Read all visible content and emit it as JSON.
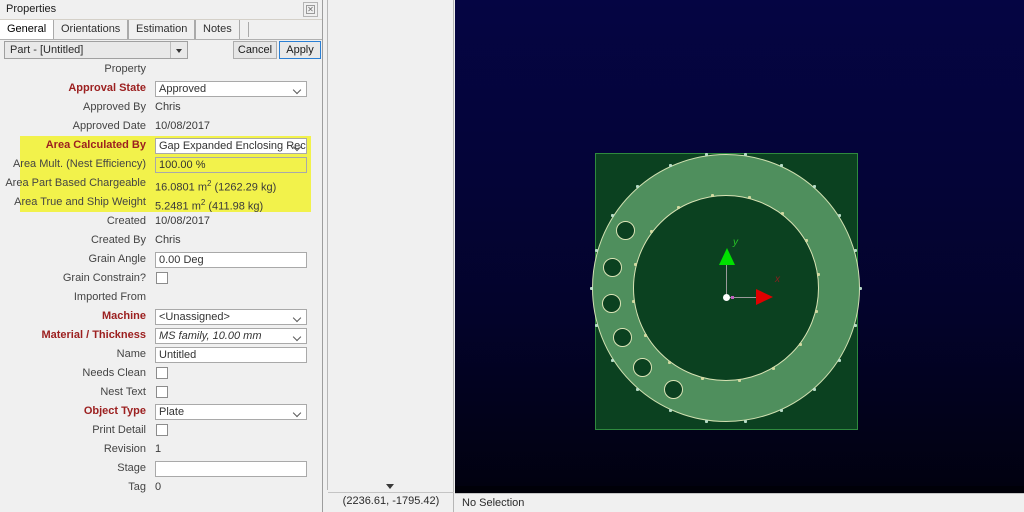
{
  "panel": {
    "title": "Properties",
    "dock_icon": "close-dock-icon",
    "tabs": [
      {
        "label": "General",
        "active": true
      },
      {
        "label": "Orientations",
        "active": false
      },
      {
        "label": "Estimation",
        "active": false
      },
      {
        "label": "Notes",
        "active": false
      }
    ],
    "part_selector": {
      "value": "Part - [Untitled]",
      "icon": "chevron-down-icon"
    },
    "cancel_label": "Cancel",
    "apply_label": "Apply",
    "header_row": "Property",
    "rows": [
      {
        "label": "Approval State",
        "value": "Approved",
        "type": "combo",
        "required": true,
        "highlight": false
      },
      {
        "label": "Approved By",
        "value": "Chris",
        "type": "text",
        "required": false,
        "highlight": false
      },
      {
        "label": "Approved Date",
        "value": "10/08/2017",
        "type": "text",
        "required": false,
        "highlight": false
      },
      {
        "label": "Area Calculated By",
        "value": "Gap Expanded Enclosing Rec",
        "type": "combo",
        "required": true,
        "highlight": true
      },
      {
        "label": "Area Mult. (Nest Efficiency)",
        "value": "100.00 %",
        "type": "input",
        "required": false,
        "highlight": true
      },
      {
        "label": "Area Part Based Chargeable",
        "value": "16.0801 m²  (1262.29 kg)",
        "type": "text",
        "required": false,
        "highlight": true
      },
      {
        "label": "Area True and Ship Weight",
        "value": "5.2481 m²  (411.98 kg)",
        "type": "text",
        "required": false,
        "highlight": true
      },
      {
        "label": "Created",
        "value": "10/08/2017",
        "type": "text",
        "required": false,
        "highlight": false
      },
      {
        "label": "Created By",
        "value": "Chris",
        "type": "text",
        "required": false,
        "highlight": false
      },
      {
        "label": "Grain Angle",
        "value": "0.00 Deg",
        "type": "input",
        "required": false,
        "highlight": false
      },
      {
        "label": "Grain Constrain?",
        "value": "",
        "type": "checkbox",
        "required": false,
        "highlight": false,
        "checked": false
      },
      {
        "label": "Imported From",
        "value": "",
        "type": "text",
        "required": false,
        "highlight": false
      },
      {
        "label": "Machine",
        "value": "<Unassigned>",
        "type": "combo",
        "required": true,
        "highlight": false
      },
      {
        "label": "Material / Thickness",
        "value": "MS family, 10.00 mm",
        "type": "combo",
        "required": true,
        "highlight": false,
        "italic": true
      },
      {
        "label": "Name",
        "value": "Untitled",
        "type": "input",
        "required": false,
        "highlight": false
      },
      {
        "label": "Needs Clean",
        "value": "",
        "type": "checkbox",
        "required": false,
        "highlight": false,
        "checked": false
      },
      {
        "label": "Nest Text",
        "value": "",
        "type": "checkbox",
        "required": false,
        "highlight": false,
        "checked": false
      },
      {
        "label": "Object Type",
        "value": "Plate",
        "type": "combo",
        "required": true,
        "highlight": false
      },
      {
        "label": "Print Detail",
        "value": "",
        "type": "checkbox",
        "required": false,
        "highlight": false,
        "checked": false
      },
      {
        "label": "Revision",
        "value": "1",
        "type": "text",
        "required": false,
        "highlight": false
      },
      {
        "label": "Stage",
        "value": "",
        "type": "input",
        "required": false,
        "highlight": false
      },
      {
        "label": "Tag",
        "value": "0",
        "type": "text",
        "required": false,
        "highlight": false
      }
    ]
  },
  "mid_strip": {
    "scroll_icon": "triangle-down-icon",
    "coordinates": "(2236.61, -1795.42)"
  },
  "viewport": {
    "axis": {
      "x_label": "x",
      "y_label": "y"
    },
    "part": {
      "shape": "annular-ring-plate",
      "hole_count": 6
    }
  },
  "statusbar": {
    "selection": "No Selection"
  },
  "colors": {
    "required_label": "#9c2020",
    "highlight": "#f2f24b",
    "accent": "#2a7fd4",
    "axis_x": "#e00000",
    "axis_y": "#00e000",
    "part_ring": "#4f8f5d",
    "sheet": "#0b4120",
    "viewport_bg_top": "#050543",
    "viewport_bg_bottom": "#01010f"
  }
}
